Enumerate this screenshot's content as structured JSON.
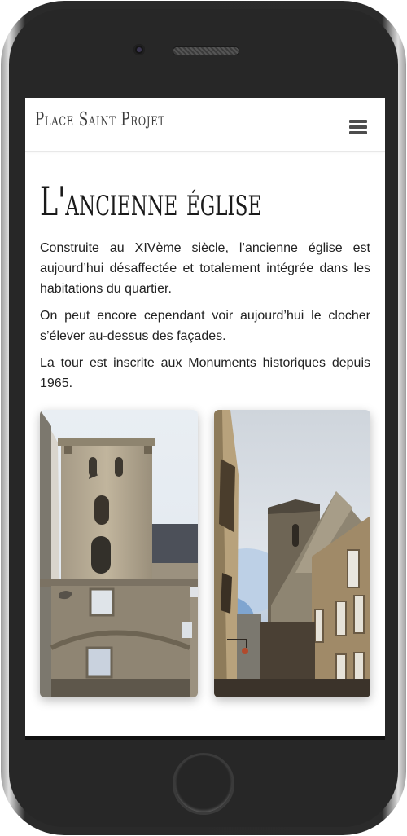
{
  "navbar": {
    "brand": "Place Saint Projet",
    "menu_icon": "hamburger-menu-icon"
  },
  "main": {
    "title": "L'ancienne église",
    "paragraphs": [
      "Construite au XIVème siècle, l’ancienne église est aujourd’hui désaffectée et totalement intégrée dans les habitations du quartier.",
      "On peut encore cependant voir aujourd’hui le clocher s’élever au-dessus des façades.",
      "La tour est inscrite aux Monuments historiques depuis 1965."
    ]
  },
  "gallery": {
    "images": [
      {
        "subject": "bell-tower-photo"
      },
      {
        "subject": "church-facade-photo"
      }
    ]
  },
  "colors": {
    "device_frame": "#272727",
    "text": "#222222",
    "brand_text": "#3b3b3b"
  }
}
